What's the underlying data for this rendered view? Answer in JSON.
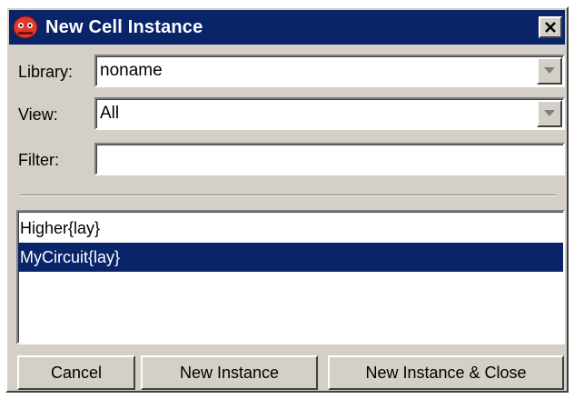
{
  "window": {
    "title": "New Cell Instance",
    "app_icon": "electric-app-icon",
    "close_icon": "close-icon"
  },
  "fields": {
    "library_label": "Library:",
    "library_value": "noname",
    "view_label": "View:",
    "view_value": "All",
    "filter_label": "Filter:",
    "filter_value": ""
  },
  "cell_list": {
    "items": [
      "Higher{lay}",
      "MyCircuit{lay}"
    ],
    "selected_index": 1
  },
  "buttons": {
    "cancel": "Cancel",
    "new_instance": "New Instance",
    "new_instance_close": "New Instance & Close"
  },
  "colors": {
    "title_bar": "#0a246a",
    "selection": "#0a246a",
    "face": "#d4d0c8"
  }
}
